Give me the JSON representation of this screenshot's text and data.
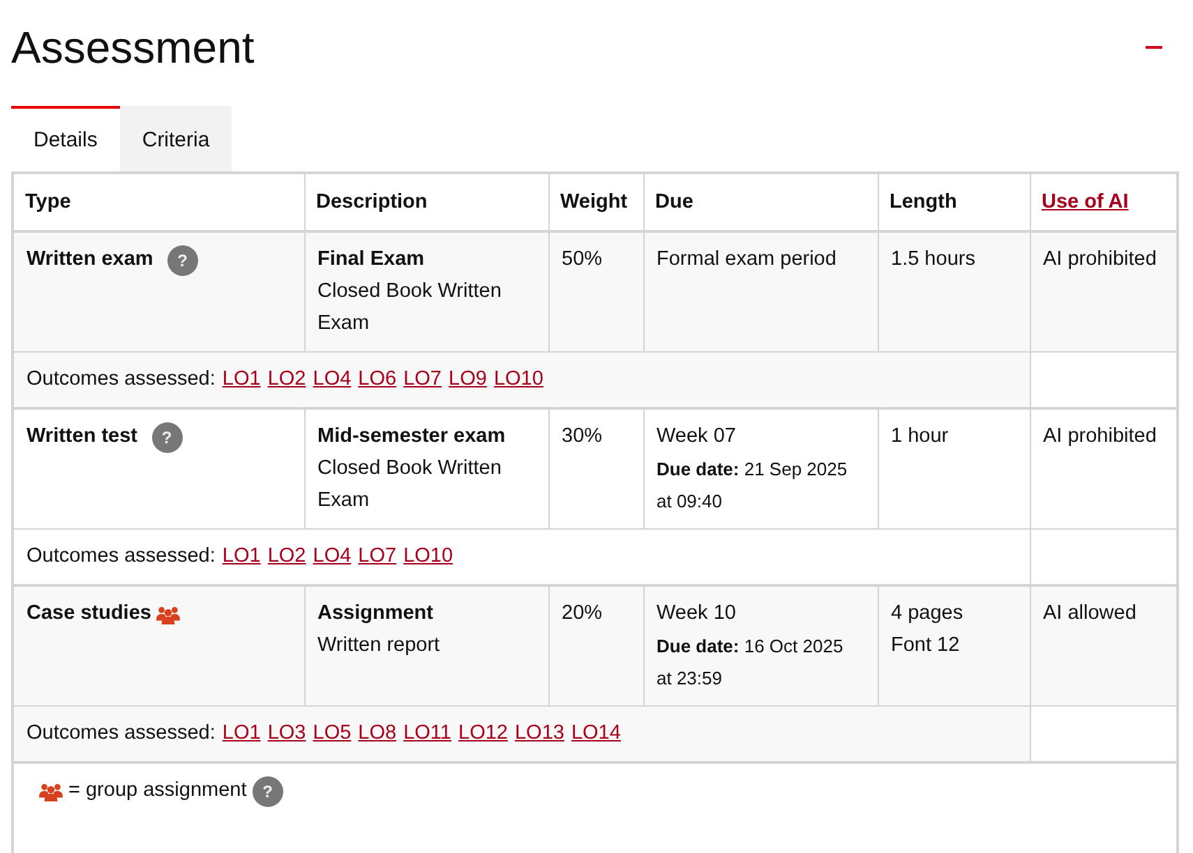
{
  "title": "Assessment",
  "tabs": [
    {
      "label": "Details",
      "selected": true
    },
    {
      "label": "Criteria",
      "selected": false
    }
  ],
  "table": {
    "columns": [
      {
        "label": "Type",
        "link": false
      },
      {
        "label": "Description",
        "link": false
      },
      {
        "label": "Weight",
        "link": false
      },
      {
        "label": "Due",
        "link": false
      },
      {
        "label": "Length",
        "link": false
      },
      {
        "label": "Use of AI",
        "link": true
      }
    ],
    "rows": [
      {
        "type": "Written exam",
        "kind": "individual",
        "help": "?",
        "title": "Final Exam",
        "description": "Closed Book Written Exam",
        "weight": "50%",
        "due": "Formal exam period",
        "due_lines": [],
        "length": [
          "1.5 hours"
        ],
        "ai": "AI prohibited",
        "outcomes_label": "Outcomes assessed:",
        "outcomes": [
          "LO1",
          "LO2",
          "LO4",
          "LO6",
          "LO7",
          "LO9",
          "LO10"
        ]
      },
      {
        "type": "Written test",
        "kind": "individual",
        "help": "?",
        "title": "Mid-semester exam",
        "description": "Closed Book Written Exam",
        "weight": "30%",
        "due": "Week 07",
        "due_lines": [
          "**Due date:** 21 Sep 2025",
          "at 09:40"
        ],
        "length": [
          "1 hour"
        ],
        "ai": "AI prohibited",
        "outcomes_label": "Outcomes assessed:",
        "outcomes": [
          "LO1",
          "LO2",
          "LO4",
          "LO7",
          "LO10"
        ]
      },
      {
        "type": "Case studies",
        "kind": "group",
        "title": "Assignment",
        "description": "Written report",
        "weight": "20%",
        "due": "Week 10",
        "due_lines": [
          "**Due date:** 16 Oct 2025",
          "at 23:59"
        ],
        "length": [
          "4 pages",
          "Font 12"
        ],
        "ai": "AI allowed",
        "outcomes_label": "Outcomes assessed:",
        "outcomes": [
          "LO1",
          "LO3",
          "LO5",
          "LO8",
          "LO11",
          "LO12",
          "LO13",
          "LO14"
        ]
      }
    ]
  },
  "legend": {
    "text": "= group assignment",
    "help": "?"
  }
}
